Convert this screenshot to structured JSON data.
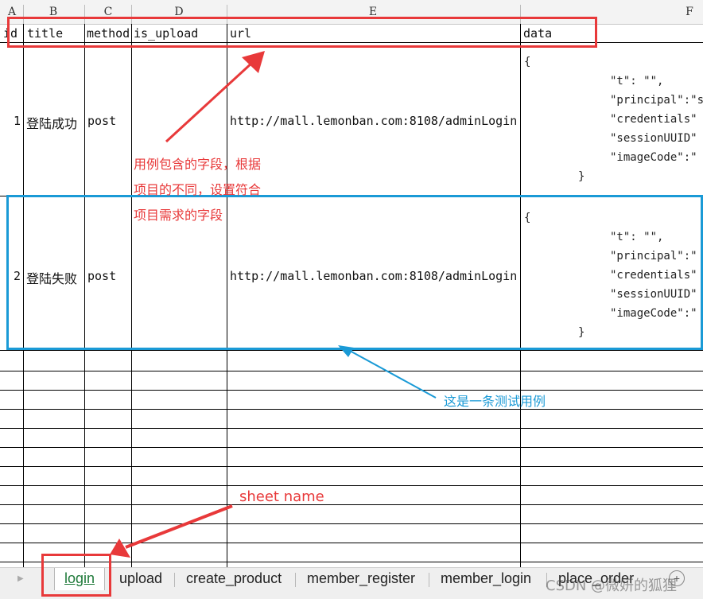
{
  "columns": {
    "letters": [
      "A",
      "B",
      "C",
      "D",
      "E",
      "F"
    ]
  },
  "header": {
    "id": "id",
    "title": "title",
    "method": "method",
    "is_upload": "is_upload",
    "url": "url",
    "data": "data"
  },
  "rows": [
    {
      "id": "1",
      "title": "登陆成功",
      "method": "post",
      "url": "http://mall.lemonban.com:8108/adminLogin",
      "data_lines": [
        "{",
        "\"t\": \"\",",
        "\"principal\":\"s",
        "\"credentials\"",
        "\"sessionUUID\"",
        "\"imageCode\":\"",
        "}"
      ]
    },
    {
      "id": "2",
      "title": "登陆失败",
      "method": "post",
      "url": "http://mall.lemonban.com:8108/adminLogin",
      "data_lines": [
        "{",
        "\"t\": \"\",",
        "\"principal\":\"",
        "\"credentials\"",
        "\"sessionUUID\"",
        "\"imageCode\":\"",
        "}"
      ]
    }
  ],
  "annotations": {
    "fields_note_line1": "用例包含的字段，根据",
    "fields_note_line2": "项目的不同，设置符合",
    "fields_note_line3": "项目需求的字段",
    "testcase_note": "这是一条测试用例",
    "sheet_name_note": "sheet  name",
    "red_color": "#e8393a",
    "blue_color": "#1a9ad6"
  },
  "tabs": [
    {
      "label": "login",
      "active": true
    },
    {
      "label": "upload",
      "active": false
    },
    {
      "label": "create_product",
      "active": false
    },
    {
      "label": "member_register",
      "active": false
    },
    {
      "label": "member_login",
      "active": false
    },
    {
      "label": "place_order",
      "active": false
    }
  ],
  "watermark": "CSDN @微妍的狐狸"
}
